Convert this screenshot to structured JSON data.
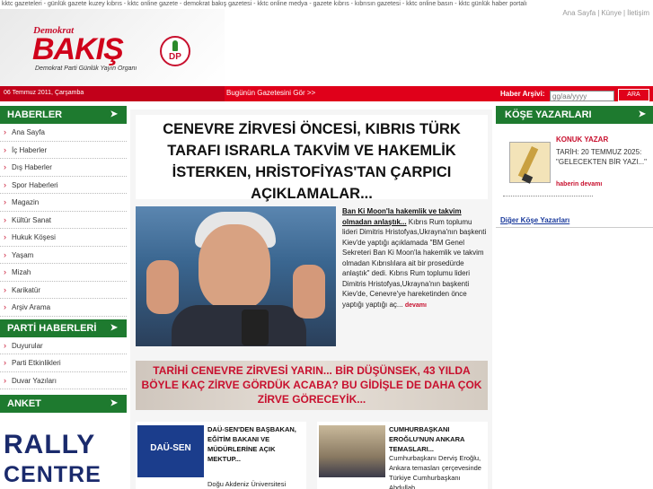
{
  "topbar": {
    "keywords": "kktc gazeteleri - günlük gazete kuzey kıbrıs - kktc online gazete - demokrat bakış gazetesi - kktc online medya - gazete kıbrıs - kıbrısın gazetesi - kktc online basın - kktc günlük haber portalı",
    "links": [
      "Ana Sayfa",
      "Künye",
      "İletişim"
    ]
  },
  "logo": {
    "small": "Demokrat",
    "big": "BAKIŞ",
    "sub": "Demokrat Parti Günlük Yayın Organı",
    "badge": "DP"
  },
  "redbar": {
    "date": "06 Temmuz 2011, Çarşamba",
    "todays_paper": "Bugünün Gazetesini Gör >>",
    "archive_label": "Haber Arşivi:",
    "archive_placeholder": "gg/aa/yyyy",
    "archive_button": "ARA"
  },
  "left": {
    "haberler_title": "HABERLER",
    "haberler": [
      "Ana Sayfa",
      "İç Haberler",
      "Dış Haberler",
      "Spor Haberleri",
      "Magazin",
      "Kültür Sanat",
      "Hukuk Köşesi",
      "Yaşam",
      "Mizah",
      "Karikatür",
      "Arşiv Arama"
    ],
    "parti_title": "PARTİ HABERLERİ",
    "parti": [
      "Duyurular",
      "Parti Etkinlikleri",
      "Duvar Yazıları"
    ],
    "anket_title": "ANKET",
    "rally_line1": "RALLY",
    "rally_line2": "CENTRE"
  },
  "center": {
    "headline": "CENEVRE ZİRVESİ ÖNCESİ, KIBRIS TÜRK TARAFI ISRARLA TAKVİM VE HAKEMLİK İSTERKEN, HRİSTOFİYAS'TAN ÇARPICI AÇIKLAMALAR...",
    "story_lead": "Ban Ki Moon'la hakemlik ve takvim olmadan anlaştık...",
    "story_body": " Kıbrıs Rum toplumu lideri Dimitris Hristofyas,Ukrayna'nın başkenti Kiev'de yaptığı açıklamada \"BM Genel Sekreteri Ban Ki Moon'la hakemlik ve takvim olmadan Kıbrıslılara ait bir prosedürde anlaştık\" dedi. Kıbrıs Rum toplumu lideri Dimitris Hristofyas,Ukrayna'nın başkenti Kiev'de, Cenevre'ye hareketinden önce yaptığı yaptığı aç... ",
    "story_more": "devamı",
    "banner2": "TARİHİ CENEVRE ZİRVESİ YARIN... BİR DÜŞÜNSEK, 43 YILDA BÖYLE KAÇ ZİRVE GÖRDÜK ACABA? BU GİDİŞLE  DE DAHA ÇOK ZİRVE GÖRECEYİK...",
    "sub1_thumb": "DAÜ-SEN",
    "sub1_title": "DAÜ-SEN'DEN BAŞBAKAN, EĞİTİM BAKANI VE MÜDÜRLERİNE AÇIK MEKTUP...",
    "sub1_body": "Doğu Akdeniz Üniversitesi Akademik Personel",
    "sub2_title": "CUMHURBAŞKANI EROĞLU'NUN ANKARA TEMASLARI...",
    "sub2_body": "Cumhurbaşkanı Derviş Eroğlu, Ankara temasları çerçevesinde Türkiye Cumhurbaşkanı Abdullah"
  },
  "right": {
    "title": "KÖŞE YAZARLARI",
    "author": "KONUK YAZAR",
    "article": "TARİH: 20 TEMMUZ 2025: \"GELECEKTEN BİR YAZI...\"",
    "more": "haberin devamı",
    "all": "Diğer Köşe Yazarları"
  }
}
